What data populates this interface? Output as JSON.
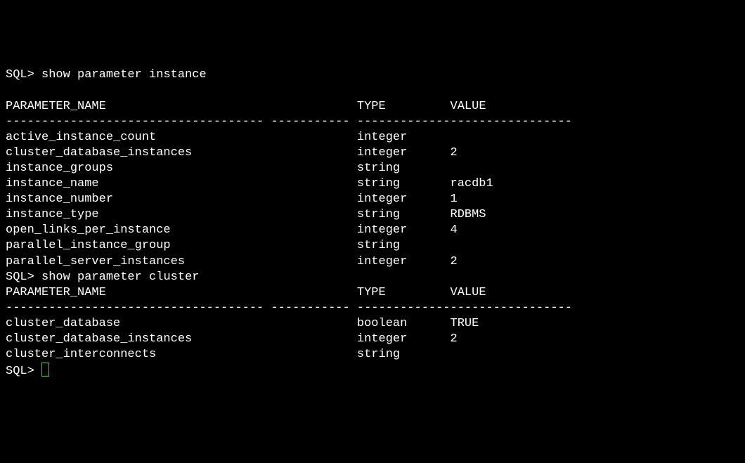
{
  "blocks": [
    {
      "prompt": "SQL> ",
      "command": "show parameter instance",
      "headers": {
        "name": "PARAMETER_NAME",
        "type": "TYPE",
        "value": "VALUE"
      },
      "rows": [
        {
          "name": "active_instance_count",
          "type": "integer",
          "value": ""
        },
        {
          "name": "cluster_database_instances",
          "type": "integer",
          "value": "2"
        },
        {
          "name": "instance_groups",
          "type": "string",
          "value": ""
        },
        {
          "name": "instance_name",
          "type": "string",
          "value": "racdb1"
        },
        {
          "name": "instance_number",
          "type": "integer",
          "value": "1"
        },
        {
          "name": "instance_type",
          "type": "string",
          "value": "RDBMS"
        },
        {
          "name": "open_links_per_instance",
          "type": "integer",
          "value": "4"
        },
        {
          "name": "parallel_instance_group",
          "type": "string",
          "value": ""
        },
        {
          "name": "parallel_server_instances",
          "type": "integer",
          "value": "2"
        }
      ]
    },
    {
      "prompt": "SQL> ",
      "command": "show parameter cluster",
      "headers": {
        "name": "PARAMETER_NAME",
        "type": "TYPE",
        "value": "VALUE"
      },
      "rows": [
        {
          "name": "cluster_database",
          "type": "boolean",
          "value": "TRUE"
        },
        {
          "name": "cluster_database_instances",
          "type": "integer",
          "value": "2"
        },
        {
          "name": "cluster_interconnects",
          "type": "string",
          "value": ""
        }
      ]
    }
  ],
  "final_prompt": "SQL> ",
  "cols": {
    "name_w": 36,
    "gap1": 13,
    "type_w": 11,
    "gap2": 2,
    "value_w": 16
  }
}
